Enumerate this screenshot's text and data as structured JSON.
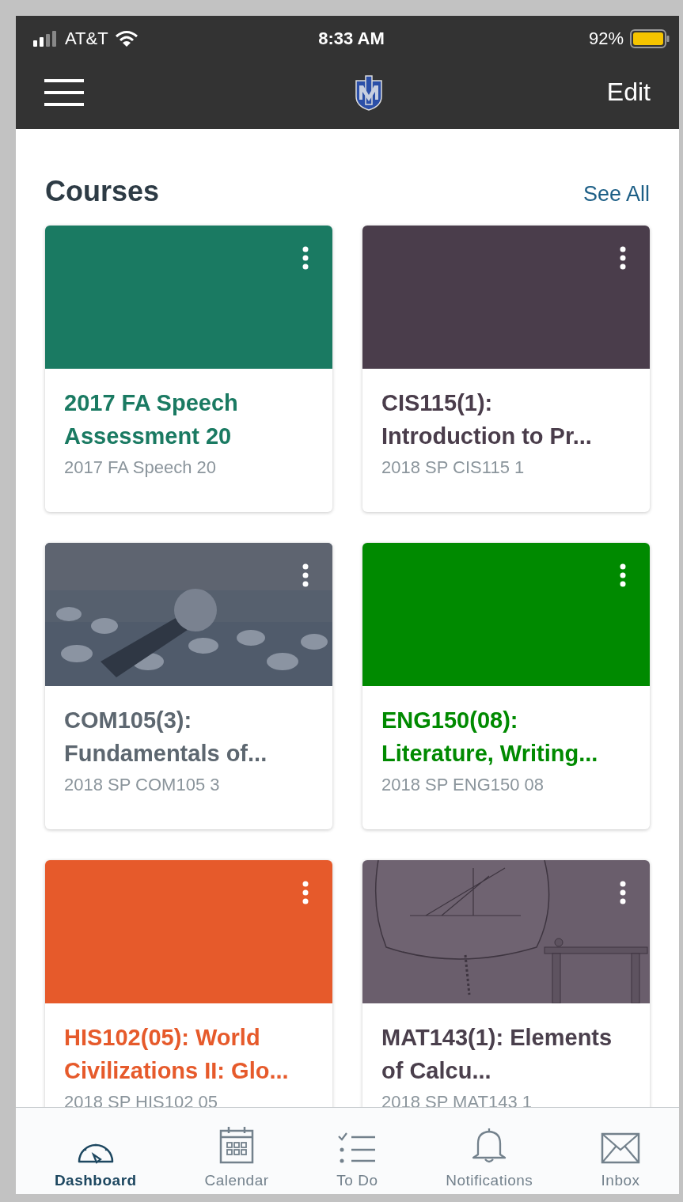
{
  "status_bar": {
    "carrier": "AT&T",
    "time": "8:33 AM",
    "battery": "92%"
  },
  "nav_bar": {
    "action": "Edit"
  },
  "courses": {
    "heading": "Courses",
    "see_all": "See All",
    "cards": [
      {
        "kind": "color",
        "color": "#1a7a62",
        "title": "2017 FA Speech Assessment 20",
        "subtitle": "2017 FA Speech 20"
      },
      {
        "kind": "color",
        "color": "#4a3d4b",
        "title": "CIS115(1): Introduction to Pr...",
        "subtitle": "2018 SP CIS115 1"
      },
      {
        "kind": "picture",
        "color": "#5d6770",
        "title": "COM105(3): Fundamentals of...",
        "subtitle": "2018 SP COM105 3"
      },
      {
        "kind": "color",
        "color": "#008a00",
        "title": "ENG150(08): Literature, Writing...",
        "subtitle": "2018 SP ENG150 08"
      },
      {
        "kind": "color",
        "color": "#e65a2b",
        "title": "HIS102(05): World Civilizations II: Glo...",
        "subtitle": "2018 SP HIS102 05"
      },
      {
        "kind": "picture",
        "color": "#4a3f4c",
        "title": "MAT143(1): Elements of Calcu...",
        "subtitle": "2018 SP MAT143 1"
      }
    ]
  },
  "tab_bar": [
    {
      "label": "Dashboard",
      "selected": true
    },
    {
      "label": "Calendar",
      "selected": false
    },
    {
      "label": "To Do",
      "selected": false
    },
    {
      "label": "Notifications",
      "selected": false
    },
    {
      "label": "Inbox",
      "selected": false
    }
  ]
}
